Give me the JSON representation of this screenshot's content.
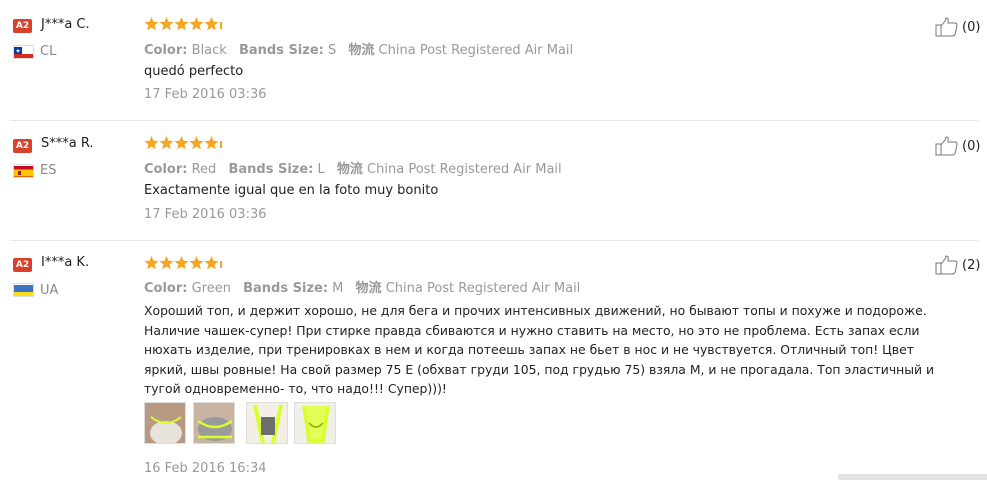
{
  "reviews": [
    {
      "badge": "A2",
      "user": "J***a C.",
      "country": "CL",
      "rating": 5,
      "color_label": "Color:",
      "color_value": "Black",
      "size_label": "Bands Size:",
      "size_value": "S",
      "ship_label": "物流",
      "ship_value": "China Post Registered Air Mail",
      "text": "quedó perfecto",
      "date": "17 Feb 2016 03:36",
      "likes": "(0)"
    },
    {
      "badge": "A2",
      "user": "S***a R.",
      "country": "ES",
      "rating": 5,
      "color_label": "Color:",
      "color_value": "Red",
      "size_label": "Bands Size:",
      "size_value": "L",
      "ship_label": "物流",
      "ship_value": "China Post Registered Air Mail",
      "text": "Exactamente igual que en la foto muy bonito",
      "date": "17 Feb 2016 03:36",
      "likes": "(0)"
    },
    {
      "badge": "A2",
      "user": "I***a K.",
      "country": "UA",
      "rating": 5,
      "color_label": "Color:",
      "color_value": "Green",
      "size_label": "Bands Size:",
      "size_value": "M",
      "ship_label": "物流",
      "ship_value": "China Post Registered Air Mail",
      "text_lines": [
        "Хороший топ, и держит хорошо, не для бега и прочих интенсивных движений, но бывают топы и похуже и подороже.",
        "Наличие чашек-супер! При стирке правда сбиваются и нужно ставить на место, но это не проблема. Есть запах если",
        "нюхать изделие, при тренировках в нем и когда потеешь запах не бьет в нос и не чувствуется. Отличный топ! Цвет",
        "яркий, швы ровные! На свой размер 75 E (обхват груди 105, под грудью 75) взяла М, и не прогадала. Топ эластичный и",
        "тугой одновременно- то, что надо!!! Супер)))!"
      ],
      "date": "16 Feb 2016 16:34",
      "likes": "(2)",
      "photos": [
        "photo-1",
        "photo-2",
        "photo-3",
        "photo-4"
      ]
    }
  ],
  "colors": {
    "star": "#f5a623",
    "badge": "#d9412b",
    "muted": "#999999"
  }
}
